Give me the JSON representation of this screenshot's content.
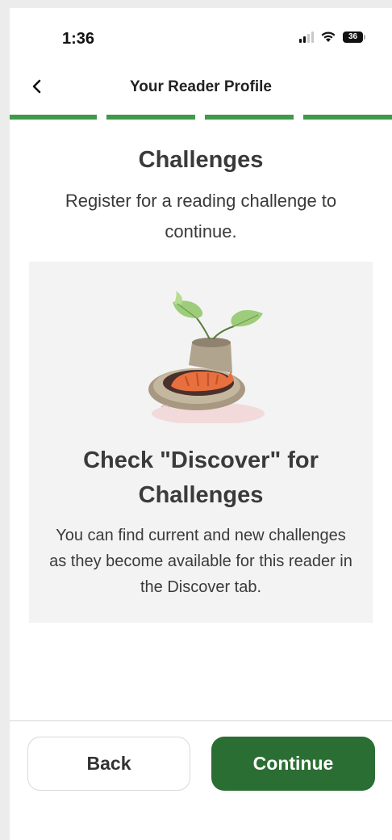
{
  "status_bar": {
    "time": "1:36",
    "battery": "36",
    "icons": [
      "signal-icon",
      "wifi-icon",
      "battery-icon"
    ]
  },
  "header": {
    "title": "Your Reader Profile",
    "back_icon": "chevron-left-icon"
  },
  "progress": {
    "total_steps": 4,
    "completed_steps": 4,
    "color": "#3f9a4a"
  },
  "main": {
    "heading": "Challenges",
    "subheading": "Register for a reading challenge to continue."
  },
  "card": {
    "illustration": "cat-bed-with-plant-illustration",
    "title": "Check \"Discover\" for Challenges",
    "body": "You can find current and new challenges as they become available for this reader in the Discover tab."
  },
  "footer": {
    "back_label": "Back",
    "continue_label": "Continue",
    "accent": "#2b6e33"
  }
}
